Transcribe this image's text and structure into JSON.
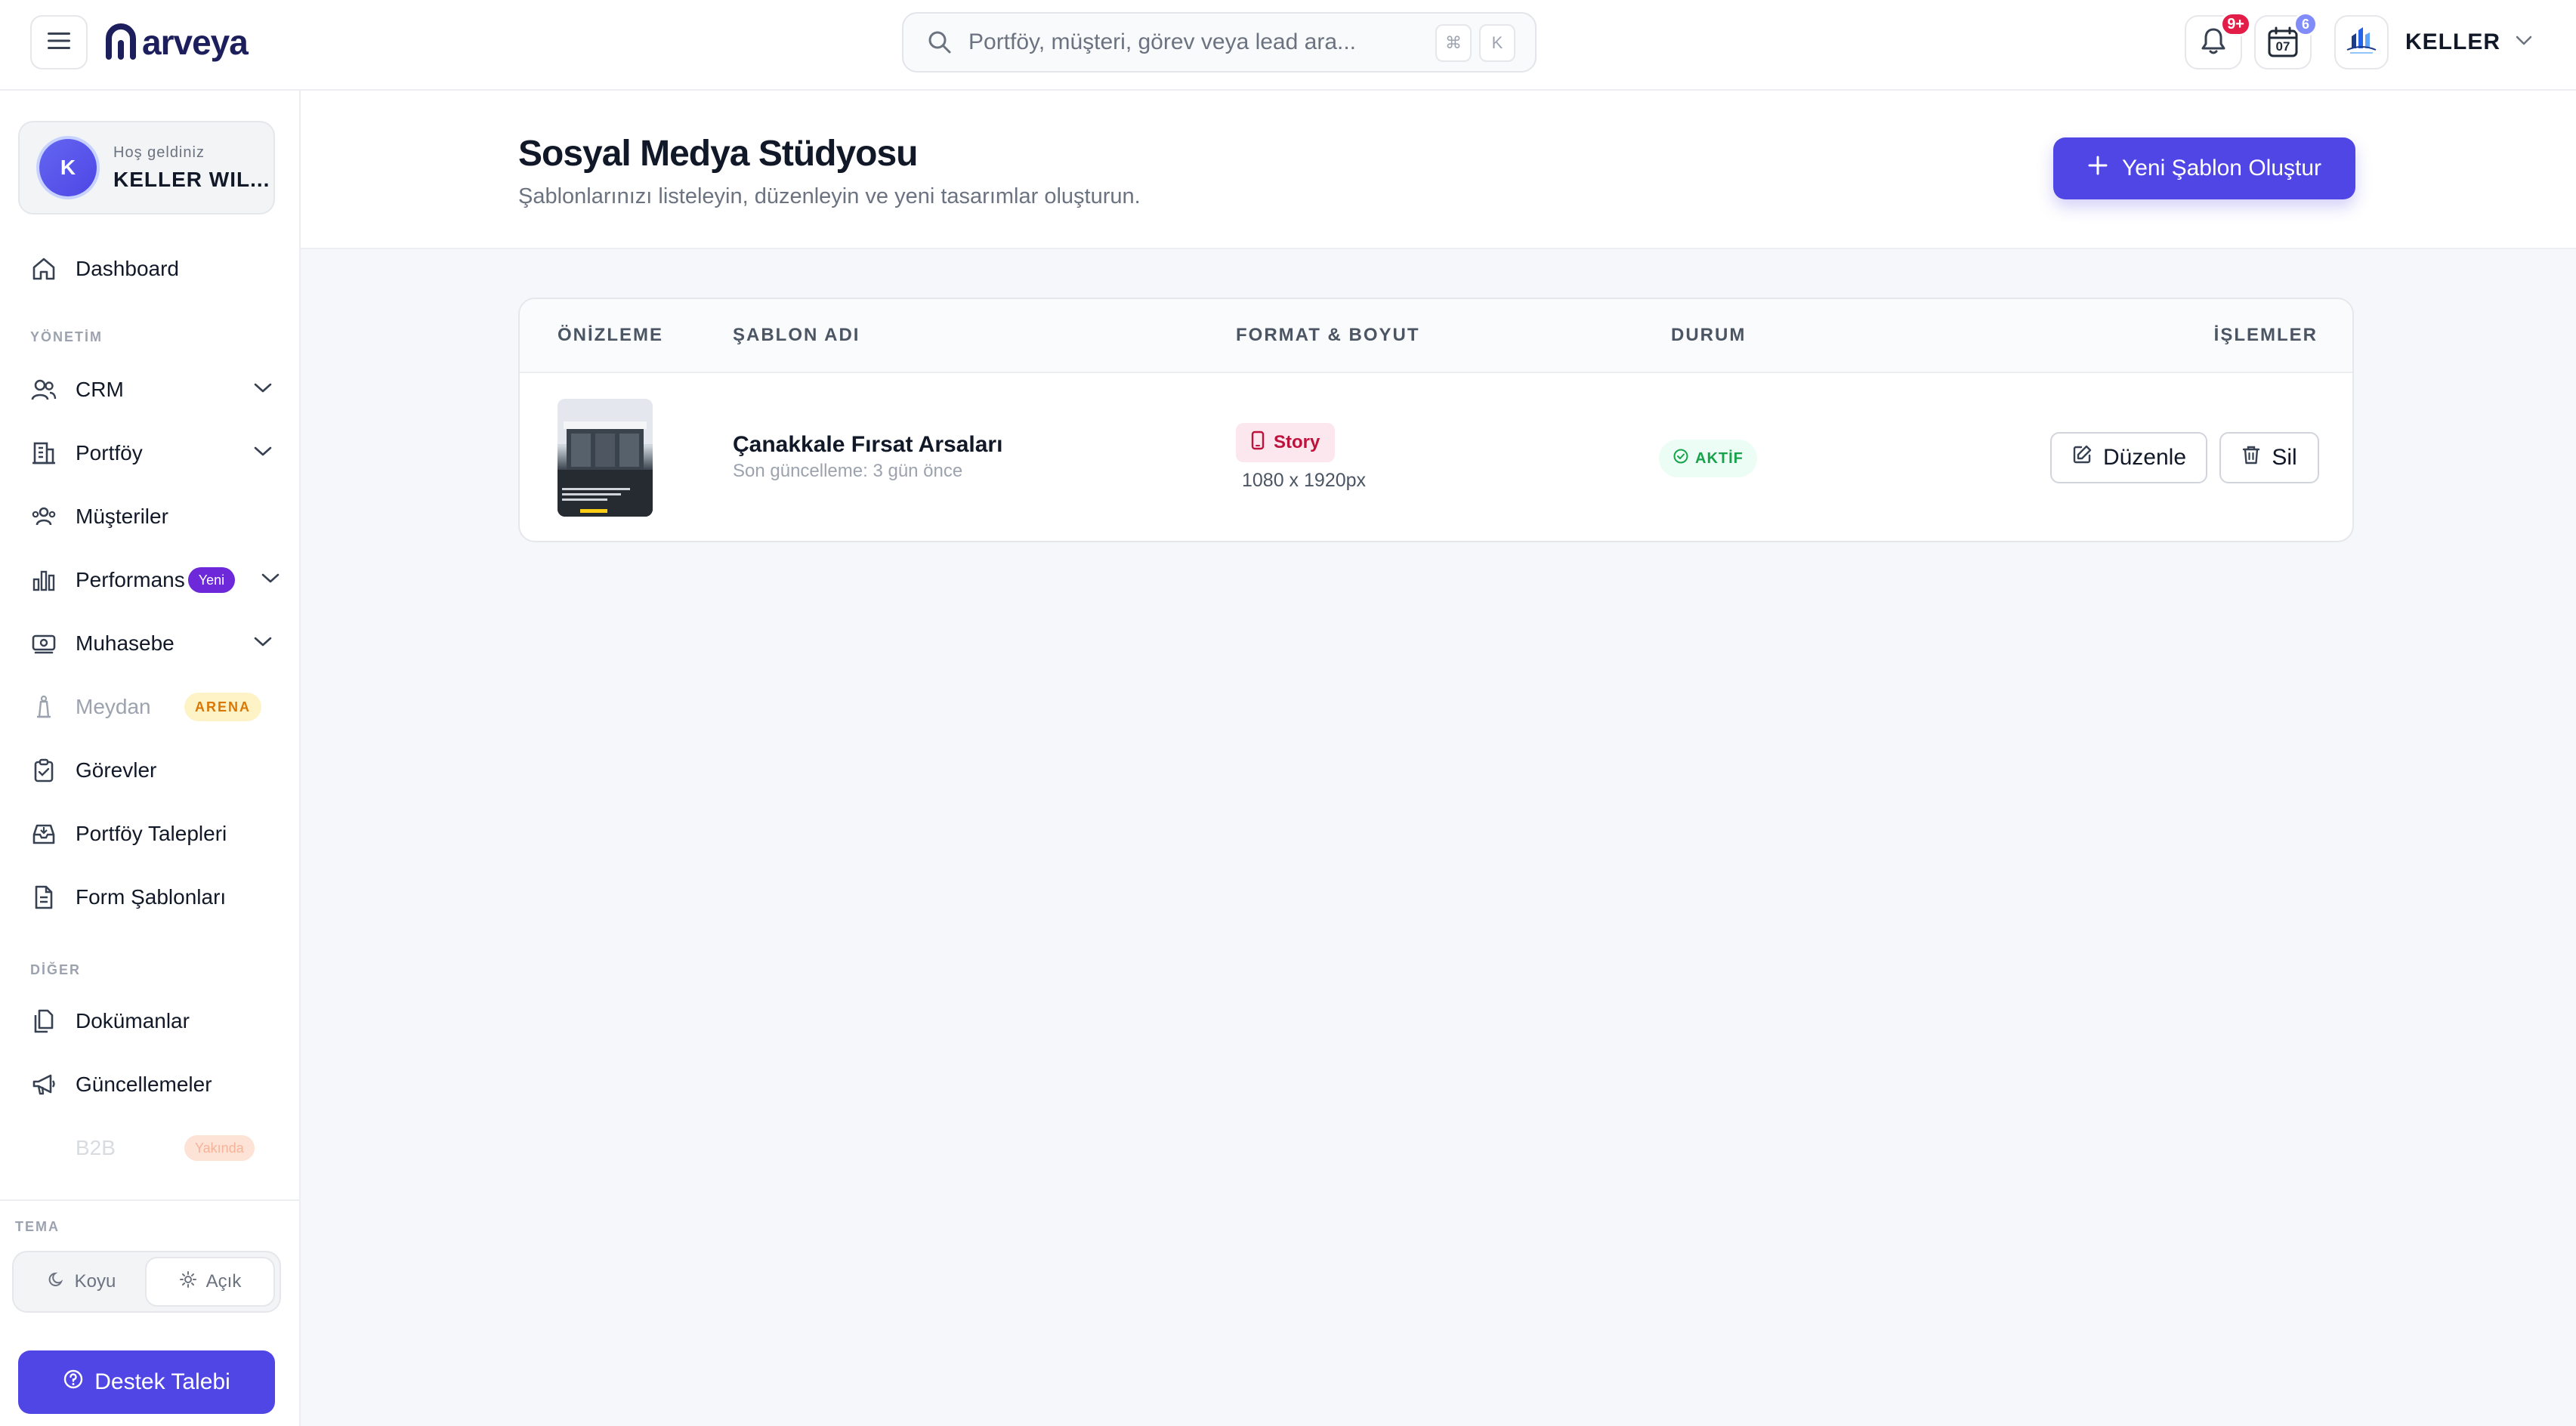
{
  "app": {
    "brand": "arveya"
  },
  "search": {
    "placeholder": "Portföy, müşteri, görev veya lead ara...",
    "shortcut_key": "K"
  },
  "header": {
    "notifications_badge": "9+",
    "calendar_day": "07",
    "calendar_badge": "6",
    "user_name": "KELLER"
  },
  "sidebar": {
    "welcome_label": "Hoş geldiniz",
    "welcome_name": "KELLER WIL...",
    "avatar_initial": "K",
    "sections": {
      "management": "YÖNETİM",
      "other": "DİĞER",
      "theme": "TEMA"
    },
    "items": [
      {
        "label": "Dashboard",
        "icon": "home-icon"
      },
      {
        "label": "CRM",
        "icon": "users-icon"
      },
      {
        "label": "Portföy",
        "icon": "building-icon"
      },
      {
        "label": "Müşteriler",
        "icon": "customers-icon"
      },
      {
        "label": "Performans",
        "icon": "chart-icon",
        "badge": "Yeni"
      },
      {
        "label": "Muhasebe",
        "icon": "money-icon"
      },
      {
        "label": "Meydan",
        "icon": "tower-icon",
        "badge": "ARENA"
      },
      {
        "label": "Görevler",
        "icon": "clipboard-icon"
      },
      {
        "label": "Portföy Talepleri",
        "icon": "inbox-icon"
      },
      {
        "label": "Form Şablonları",
        "icon": "document-icon"
      },
      {
        "label": "Dokümanlar",
        "icon": "files-icon"
      },
      {
        "label": "Güncellemeler",
        "icon": "megaphone-icon"
      },
      {
        "label": "B2B",
        "badge": "Yakında"
      }
    ],
    "theme": {
      "dark": "Koyu",
      "light": "Açık",
      "active": "light"
    },
    "support": "Destek Talebi"
  },
  "page": {
    "title": "Sosyal Medya Stüdyosu",
    "subtitle": "Şablonlarınızı listeleyin, düzenleyin ve yeni tasarımlar oluşturun.",
    "new_button": "Yeni Şablon Oluştur"
  },
  "table": {
    "columns": [
      "ÖNİZLEME",
      "ŞABLON ADI",
      "FORMAT & BOYUT",
      "DURUM",
      "İŞLEMLER"
    ],
    "rows": [
      {
        "name": "Çanakkale Fırsat Arsaları",
        "updated": "Son güncelleme: 3 gün önce",
        "format": "Story",
        "size": "1080 x 1920px",
        "status": "AKTİF",
        "actions": {
          "edit": "Düzenle",
          "delete": "Sil"
        }
      }
    ]
  },
  "colors": {
    "primary": "#4f46e5",
    "status_active": "#16a34a",
    "format_story": "#be123c",
    "notification_badge": "#e11d48"
  }
}
